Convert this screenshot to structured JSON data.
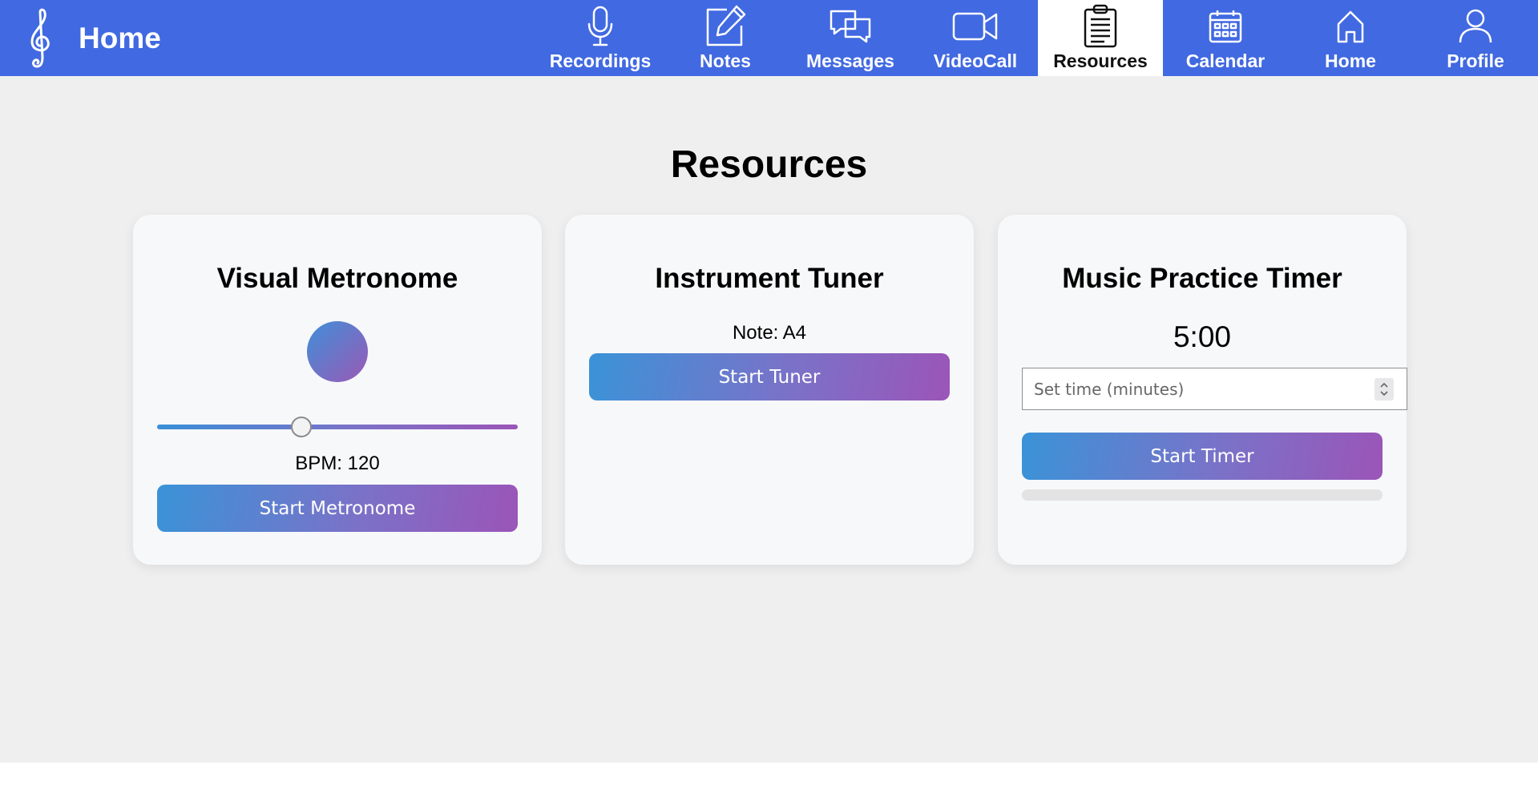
{
  "brand": {
    "title": "Home",
    "logo_icon": "treble-clef-icon"
  },
  "nav": {
    "items": [
      {
        "label": "Recordings",
        "icon": "microphone-icon",
        "active": false
      },
      {
        "label": "Notes",
        "icon": "pencil-square-icon",
        "active": false
      },
      {
        "label": "Messages",
        "icon": "chat-bubbles-icon",
        "active": false
      },
      {
        "label": "VideoCall",
        "icon": "video-camera-icon",
        "active": false
      },
      {
        "label": "Resources",
        "icon": "clipboard-icon",
        "active": true
      },
      {
        "label": "Calendar",
        "icon": "calendar-icon",
        "active": false
      },
      {
        "label": "Home",
        "icon": "house-icon",
        "active": false
      },
      {
        "label": "Profile",
        "icon": "person-icon",
        "active": false
      }
    ]
  },
  "colors": {
    "navbar": "#4169e1",
    "page_bg": "#efefef",
    "card_bg": "#f7f8fa",
    "gradient_start": "#3a93d8",
    "gradient_end": "#9b55b8"
  },
  "main": {
    "title": "Resources",
    "metronome": {
      "title": "Visual Metronome",
      "bpm_label": "BPM: 120",
      "bpm_value": 120,
      "slider_fraction": 0.4,
      "button_label": "Start Metronome"
    },
    "tuner": {
      "title": "Instrument Tuner",
      "note_label": "Note: A4",
      "button_label": "Start Tuner"
    },
    "timer": {
      "title": "Music Practice Timer",
      "display": "5:00",
      "input_placeholder": "Set time (minutes)",
      "button_label": "Start Timer",
      "progress_fraction": 0
    }
  }
}
